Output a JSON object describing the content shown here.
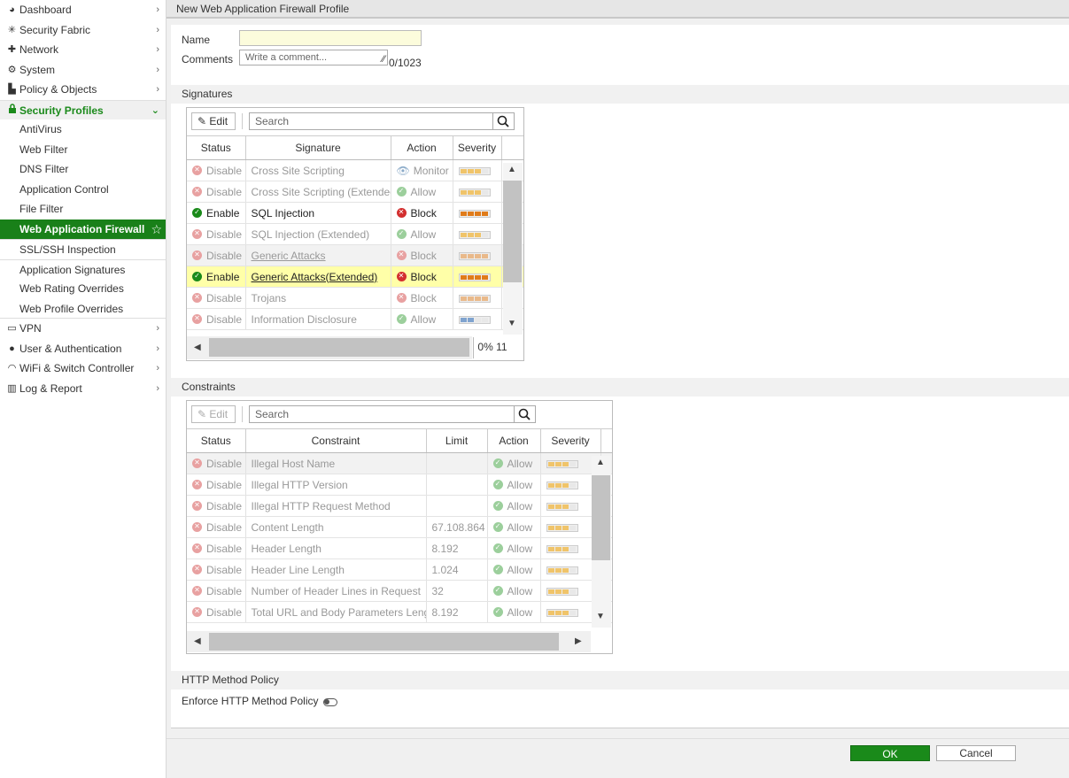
{
  "sidebar": {
    "items": [
      {
        "label": "Dashboard",
        "icon": "dashboard-icon",
        "glyph": "◕"
      },
      {
        "label": "Security Fabric",
        "icon": "security-fabric-icon",
        "glyph": "✳"
      },
      {
        "label": "Network",
        "icon": "network-icon",
        "glyph": "✚"
      },
      {
        "label": "System",
        "icon": "system-gear-icon",
        "glyph": "⚙"
      },
      {
        "label": "Policy & Objects",
        "icon": "policy-icon",
        "glyph": "▙"
      },
      {
        "label": "Security Profiles",
        "icon": "lock-icon",
        "glyph": "🔒"
      }
    ],
    "sub_items": [
      "AntiVirus",
      "Web Filter",
      "DNS Filter",
      "Application Control",
      "File Filter",
      "Web Application Firewall",
      "SSL/SSH Inspection",
      "Application Signatures",
      "Web Rating Overrides",
      "Web Profile Overrides"
    ],
    "bottom_items": [
      {
        "label": "VPN",
        "icon": "vpn-laptop-icon",
        "glyph": "▭"
      },
      {
        "label": "User & Authentication",
        "icon": "user-icon",
        "glyph": "●"
      },
      {
        "label": "WiFi & Switch Controller",
        "icon": "wifi-icon",
        "glyph": "◠"
      },
      {
        "label": "Log & Report",
        "icon": "log-report-icon",
        "glyph": "▥"
      }
    ]
  },
  "header": {
    "title": "New Web Application Firewall Profile"
  },
  "form": {
    "name_label": "Name",
    "name_value": "",
    "comments_label": "Comments",
    "comments_placeholder": "Write a comment...",
    "comments_counter": "0/1023"
  },
  "signatures": {
    "section_title": "Signatures",
    "edit_label": "Edit",
    "search_placeholder": "Search",
    "columns": [
      "Status",
      "Signature",
      "Action",
      "Severity"
    ],
    "rows": [
      {
        "status": "Disable",
        "enabled": false,
        "name": "Cross Site Scripting",
        "action": "Monitor",
        "action_type": "monitor",
        "severity": 3,
        "sev_color": "#f0c46a",
        "underline": false
      },
      {
        "status": "Disable",
        "enabled": false,
        "name": "Cross Site Scripting (Extended)",
        "action": "Allow",
        "action_type": "allow",
        "severity": 3,
        "sev_color": "#f0c46a",
        "underline": false
      },
      {
        "status": "Enable",
        "enabled": true,
        "name": "SQL Injection",
        "action": "Block",
        "action_type": "block",
        "severity": 4,
        "sev_color": "#e07b1a",
        "underline": false
      },
      {
        "status": "Disable",
        "enabled": false,
        "name": "SQL Injection (Extended)",
        "action": "Allow",
        "action_type": "allow",
        "severity": 3,
        "sev_color": "#f0c46a",
        "underline": false
      },
      {
        "status": "Disable",
        "enabled": false,
        "name": "Generic Attacks",
        "action": "Block",
        "action_type": "block",
        "severity": 4,
        "sev_color": "#e9b98a",
        "underline": true
      },
      {
        "status": "Enable",
        "enabled": true,
        "name": "Generic Attacks(Extended)",
        "action": "Block",
        "action_type": "block",
        "severity": 4,
        "sev_color": "#e07b1a",
        "underline": true
      },
      {
        "status": "Disable",
        "enabled": false,
        "name": "Trojans",
        "action": "Block",
        "action_type": "block",
        "severity": 4,
        "sev_color": "#e9b98a",
        "underline": false
      },
      {
        "status": "Disable",
        "enabled": false,
        "name": "Information Disclosure",
        "action": "Allow",
        "action_type": "allow",
        "severity": 2,
        "sev_color": "#7fa3cf",
        "underline": false
      }
    ],
    "pager": "0% 11"
  },
  "constraints": {
    "section_title": "Constraints",
    "edit_label": "Edit",
    "search_placeholder": "Search",
    "columns": [
      "Status",
      "Constraint",
      "Limit",
      "Action",
      "Severity"
    ],
    "rows": [
      {
        "status": "Disable",
        "name": "Illegal Host Name",
        "limit": "",
        "action": "Allow"
      },
      {
        "status": "Disable",
        "name": "Illegal HTTP Version",
        "limit": "",
        "action": "Allow"
      },
      {
        "status": "Disable",
        "name": "Illegal HTTP Request Method",
        "limit": "",
        "action": "Allow"
      },
      {
        "status": "Disable",
        "name": "Content Length",
        "limit": "67.108.864",
        "action": "Allow"
      },
      {
        "status": "Disable",
        "name": "Header Length",
        "limit": "8.192",
        "action": "Allow"
      },
      {
        "status": "Disable",
        "name": "Header Line Length",
        "limit": "1.024",
        "action": "Allow"
      },
      {
        "status": "Disable",
        "name": "Number of Header Lines in Request",
        "limit": "32",
        "action": "Allow"
      },
      {
        "status": "Disable",
        "name": "Total URL and Body Parameters Length",
        "limit": "8.192",
        "action": "Allow"
      }
    ],
    "severity_level": 3,
    "severity_color": "#f0c46a"
  },
  "http_method": {
    "section_title": "HTTP Method Policy",
    "enforce_label": "Enforce HTTP Method Policy",
    "enforce_enabled": false
  },
  "footer": {
    "ok_label": "OK",
    "cancel_label": "Cancel"
  }
}
